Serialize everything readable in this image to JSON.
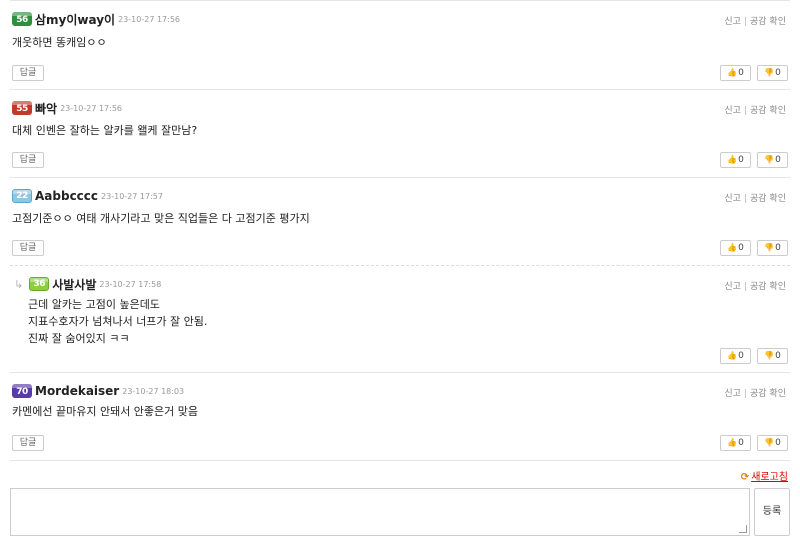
{
  "comments": [
    {
      "badge": "56",
      "nick": "삼my이way이",
      "time": "23-10-27 17:56",
      "lines": [
        "개웃하면 똥캐임ㅇㅇ"
      ],
      "report": "신고",
      "empathy": "공감 확인",
      "reply_label": "답글",
      "up": "0",
      "down": "0"
    },
    {
      "badge": "55",
      "nick": "빠악",
      "time": "23-10-27 17:56",
      "lines": [
        "대체 인벤은 잘하는 알카를 왤케 잘만남?"
      ],
      "report": "신고",
      "empathy": "공감 확인",
      "reply_label": "답글",
      "up": "0",
      "down": "0"
    },
    {
      "badge": "22",
      "nick": "Aabbcccc",
      "time": "23-10-27 17:57",
      "lines": [
        "고점기준ㅇㅇ 여태 개사기라고 맞은 직업들은 다 고점기준 평가지"
      ],
      "report": "신고",
      "empathy": "공감 확인",
      "reply_label": "답글",
      "up": "0",
      "down": "0"
    },
    {
      "badge": "36",
      "nick": "사발사발",
      "time": "23-10-27 17:58",
      "lines": [
        "근데 알카는 고점이 높은데도",
        "지표수호자가 넘쳐나서 너프가 잘 안됨.",
        "진짜 잘 숨어있지 ㅋㅋ"
      ],
      "report": "신고",
      "empathy": "공감 확인",
      "reply_arrow": "↳",
      "up": "0",
      "down": "0"
    },
    {
      "badge": "70",
      "nick": "Mordekaiser",
      "time": "23-10-27 18:03",
      "lines": [
        "카멘에선 끝마유지 안돼서 안좋은거 맞음"
      ],
      "report": "신고",
      "empathy": "공감 확인",
      "reply_label": "답글",
      "up": "0",
      "down": "0"
    }
  ],
  "refresh_label": "새로고침",
  "submit_label": "등록",
  "icons": {
    "up": "thumbs-up-icon",
    "down": "thumbs-down-icon",
    "refresh": "refresh-icon"
  },
  "colors": {
    "refresh": "#dd0000",
    "badge_green": "#2f8f3f",
    "badge_red": "#c0392b",
    "badge_purple": "#5a3aa8"
  }
}
